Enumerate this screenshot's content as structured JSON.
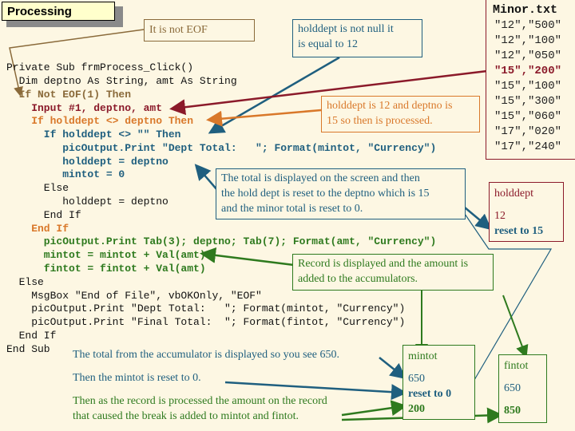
{
  "title": "Processing",
  "callouts": {
    "not_eof": "It is not EOF",
    "not_null_1": "holddept is not null it",
    "not_null_2": "is equal to 12",
    "processed_1": "holddept is 12 and deptno is",
    "processed_2": "15 so then is processed.",
    "total_1": "The total is displayed on the screen and then",
    "total_2": "the hold dept is reset to the deptno which is 15",
    "total_3": "and the minor total is reset to 0.",
    "record_1": "Record is displayed and the amount is",
    "record_2": "added to the accumulators."
  },
  "minor_file": {
    "name": "Minor.txt",
    "records": [
      "\"12\",\"500\"",
      "\"12\",\"100\"",
      "\"12\",\"050\"",
      "\"15\",\"200\"",
      "\"15\",\"100\"",
      "\"15\",\"300\"",
      "\"15\",\"060\"",
      "\"17\",\"020\"",
      "\"17\",\"240\""
    ],
    "highlighted_index": 3
  },
  "code": [
    "Private Sub frmProcess_Click()",
    "  Dim deptno As String, amt As String",
    "  If Not EOF(1) Then",
    "    Input #1, deptno, amt",
    "    If holddept <> deptno Then",
    "      If holddept <> \"\" Then",
    "         picOutput.Print \"Dept Total:   \"; Format(mintot, \"Currency\")",
    "         holddept = deptno",
    "         mintot = 0",
    "      Else",
    "         holddept = deptno",
    "      End If",
    "    End If",
    "      picOutput.Print Tab(3); deptno; Tab(7); Format(amt, \"Currency\")",
    "      mintot = mintot + Val(amt)",
    "      fintot = fintot + Val(amt)",
    "  Else",
    "    MsgBox \"End of File\", vbOKOnly, \"EOF\"",
    "    picOutput.Print \"Dept Total:   \"; Format(mintot, \"Currency\")",
    "    picOutput.Print \"Final Total:  \"; Format(fintot, \"Currency\")",
    "  End If",
    "End Sub"
  ],
  "holddept_box": {
    "label": "holddept",
    "old": "12",
    "new": "reset to 15"
  },
  "mintot_box": {
    "label": "mintot",
    "v1": "650",
    "v2": "reset to 0",
    "v3": "200"
  },
  "fintot_box": {
    "label": "fintot",
    "v1": "650",
    "v2": "850"
  },
  "bottom_notes": {
    "n1": "The total from the accumulator is displayed so you see 650.",
    "n2": "Then the mintot is reset to 0.",
    "n3a": "Then as the record is processed the amount on the record",
    "n3b": "that caused the break is added to mintot and fintot."
  },
  "colors": {
    "maroon": "#8b1a2a",
    "orange": "#d9782a",
    "teal": "#1f5f7f",
    "green": "#2e7a1e",
    "brown": "#8a6a3a",
    "background": "#fdf7e3"
  }
}
